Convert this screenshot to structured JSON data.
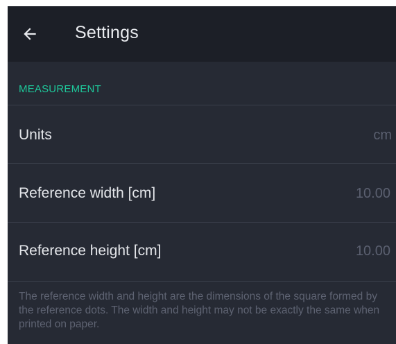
{
  "appbar": {
    "title": "Settings",
    "back_icon": "arrow-left-icon"
  },
  "section": {
    "title": "MEASUREMENT"
  },
  "settings": [
    {
      "label": "Units",
      "value": "cm"
    },
    {
      "label": "Reference width [cm]",
      "value": "10.00"
    },
    {
      "label": "Reference height [cm]",
      "value": "10.00"
    }
  ],
  "note": "The reference width and height are the dimensions of the square formed by the reference dots. The width and height may not be exactly the same when printed on paper.",
  "colors": {
    "background": "#262a34",
    "appbar": "#1c1f27",
    "accent": "#1ec79a",
    "divider": "#3a3f4b"
  }
}
